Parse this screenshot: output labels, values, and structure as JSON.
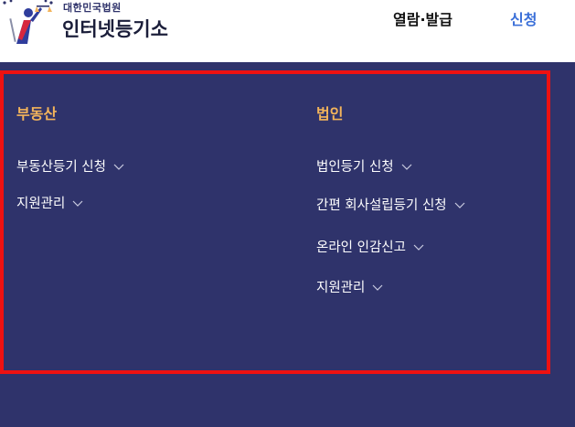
{
  "header": {
    "logo_small": "대한민국법원",
    "logo_big": "인터넷등기소",
    "nav": [
      {
        "label": "열람·발급"
      },
      {
        "label": "신청"
      }
    ]
  },
  "menu": {
    "left": {
      "title": "부동산",
      "items": [
        {
          "label": "부동산등기 신청"
        },
        {
          "label": "지원관리"
        }
      ]
    },
    "right": {
      "title": "법인",
      "items": [
        {
          "label": "법인등기 신청"
        },
        {
          "label": "간편 회사설립등기 신청"
        },
        {
          "label": "온라인 인감신고"
        },
        {
          "label": "지원관리"
        }
      ]
    }
  },
  "colors": {
    "panel_bg": "#2f336b",
    "highlight_border": "#ee1111",
    "section_title": "#f3b45b",
    "nav_active": "#3a6fd8"
  },
  "icons": [
    "court-emblem-icon",
    "chevron-down-icon"
  ]
}
